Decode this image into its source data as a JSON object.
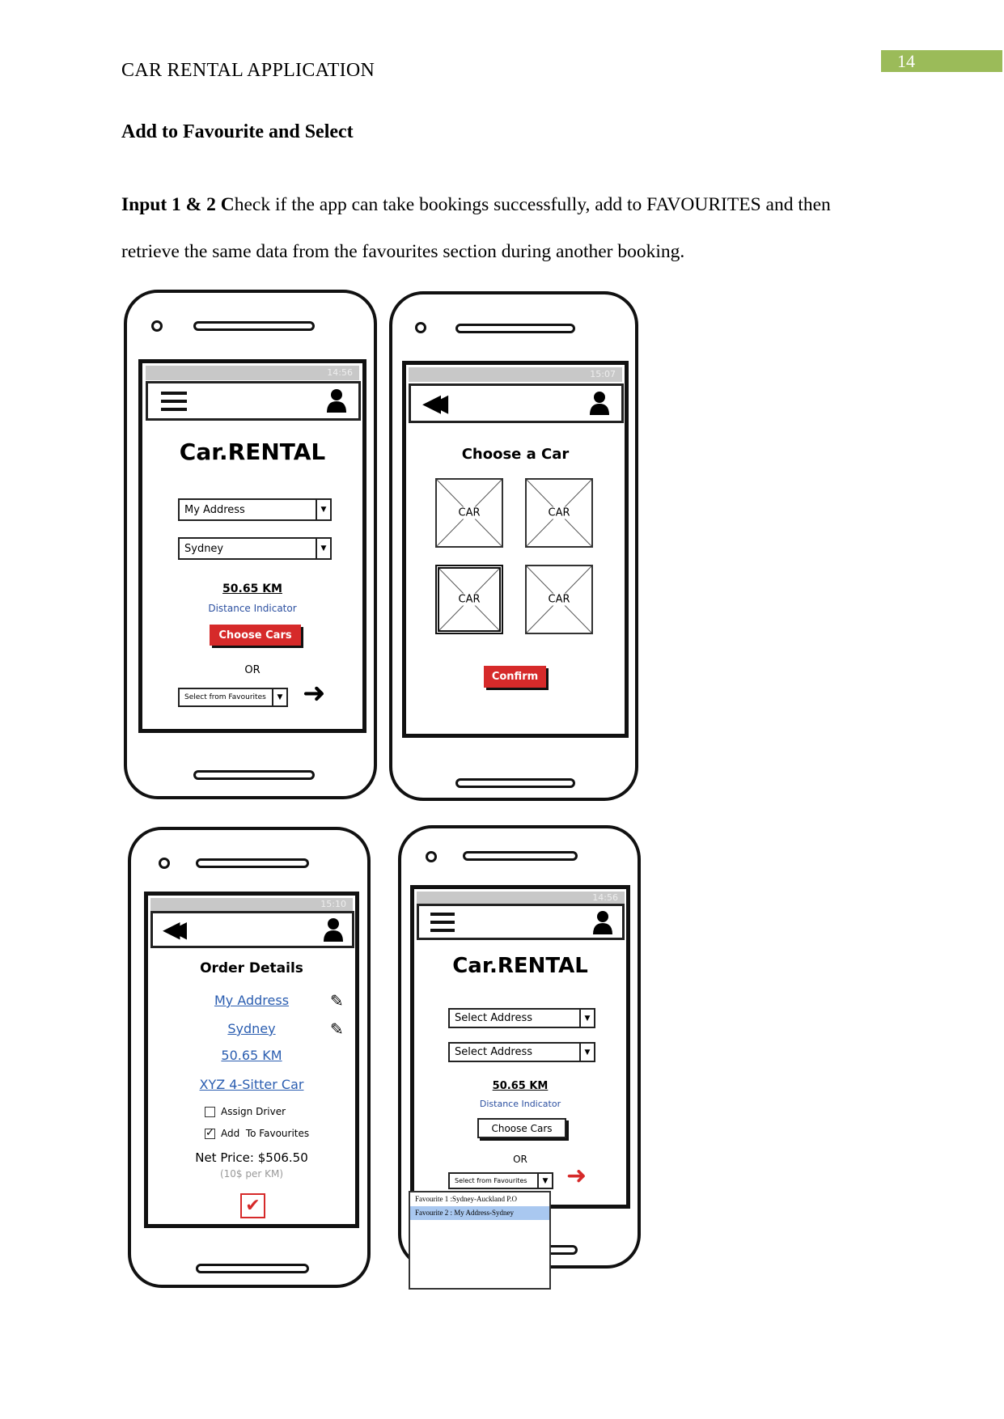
{
  "header": {
    "running_title": "CAR RENTAL APPLICATION",
    "page_number": "14"
  },
  "section_heading": "Add to Favourite and Select",
  "paragraph": {
    "bold_lead": "Input 1 & 2 C",
    "text_line1": "heck if the app can take bookings successfully, add to FAVOURITES and then",
    "text_line2": "retrieve the same data from the favourites section during another booking."
  },
  "colors": {
    "accent_red": "#d62a2a",
    "link_blue": "#2a5db0",
    "page_box_green": "#9bbb59"
  },
  "phone1": {
    "time": "14:56",
    "title": "Car.RENTAL",
    "from": "My Address",
    "to": "Sydney",
    "distance": "50.65 KM",
    "distance_label": "Distance Indicator",
    "choose_btn": "Choose Cars",
    "or": "OR",
    "favourites_placeholder": "Select from Favourites",
    "icons": [
      "menu-icon",
      "user-icon",
      "arrow-right-icon"
    ]
  },
  "phone2": {
    "time": "15:07",
    "title": "Choose a Car",
    "cars": [
      "CAR",
      "CAR",
      "CAR",
      "CAR"
    ],
    "selected_car": 2,
    "confirm_btn": "Confirm",
    "icons": [
      "back-icon",
      "user-icon"
    ]
  },
  "phone3": {
    "time": "15:10",
    "title": "Order Details",
    "from": "My Address",
    "to": "Sydney",
    "distance": "50.65 KM",
    "car": "XYZ 4-Sitter Car",
    "assign_driver": {
      "label": "Assign Driver",
      "checked": false
    },
    "add_favourites": {
      "label": "Add  To Favourites",
      "checked": true
    },
    "net_price": "Net Price: $506.50",
    "rate": "(10$ per KM)",
    "icons": [
      "back-icon",
      "user-icon",
      "pencil-icon",
      "check-icon"
    ]
  },
  "phone4": {
    "time": "14:56",
    "title": "Car.RENTAL",
    "from_placeholder": "Select Address",
    "to_placeholder": "Select Address",
    "distance": "50.65 KM",
    "distance_label": "Distance Indicator",
    "choose_btn": "Choose Cars",
    "or": "OR",
    "favourites_placeholder": "Select from Favourites",
    "favourites": [
      "Favourite 1 :Sydney-Auckland P.O",
      "Favourite 2 : My Address-Sydney"
    ],
    "highlighted_favourite": 1,
    "icons": [
      "menu-icon",
      "user-icon",
      "arrow-right-icon"
    ]
  }
}
